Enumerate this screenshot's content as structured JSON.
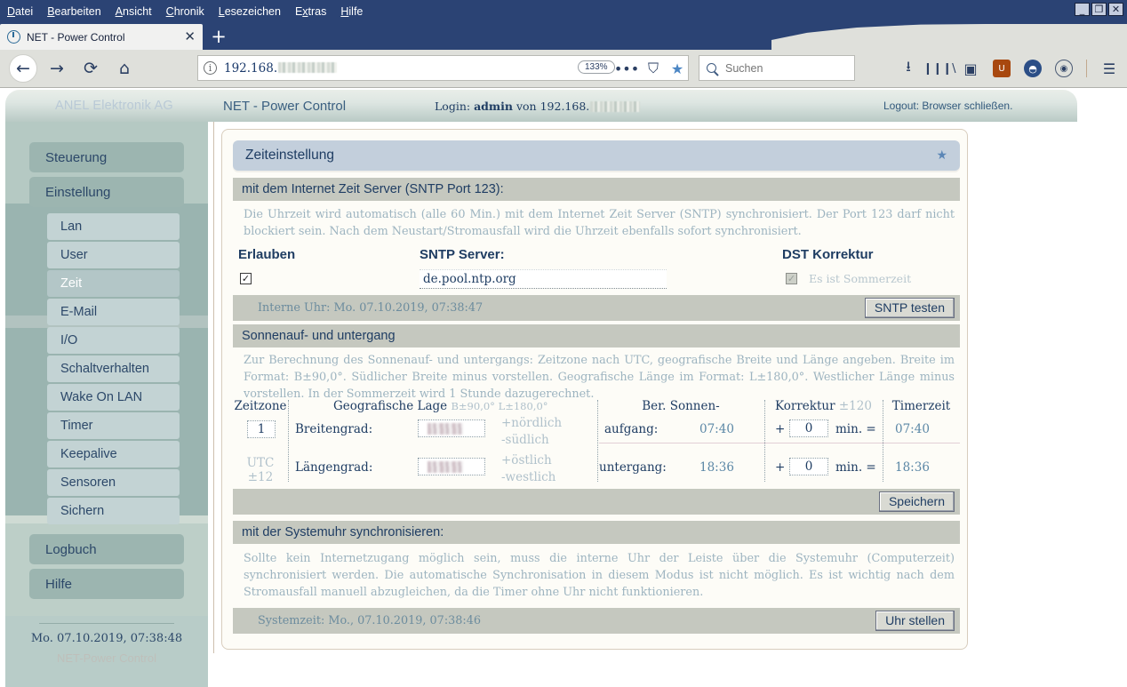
{
  "window": {
    "menu": [
      "Datei",
      "Bearbeiten",
      "Ansicht",
      "Chronik",
      "Lesezeichen",
      "Extras",
      "Hilfe"
    ],
    "controls": {
      "minimize": "_",
      "restore": "❐",
      "close": "✕"
    }
  },
  "browser": {
    "tab_title": "NET - Power Control",
    "tab_close": "✕",
    "new_tab": "+",
    "back": "←",
    "forward": "→",
    "reload": "⟳",
    "home": "⌂",
    "url_prefix": "192.168.",
    "zoom_level": "133%",
    "page_actions": "•••",
    "reader_icon": "⛉",
    "bookmark_star": "★",
    "search_placeholder": "Suchen",
    "search_value": "",
    "toolbar_icons": [
      "download-icon",
      "library-icon",
      "sidebar-icon",
      "shield-icon",
      "account-icon",
      "pocket-icon",
      "menu-icon"
    ],
    "download_glyph": "⭳",
    "library_glyph": "❙❙❙\\",
    "sidebar_glyph": "▣",
    "shield_glyph": "U",
    "account_glyph": "◓",
    "pocket_glyph": "◉",
    "menu_glyph": "☰"
  },
  "app": {
    "brand": "ANEL Elektronik AG",
    "title": "NET - Power Control",
    "login_prefix": "Login:",
    "login_user": "admin",
    "login_mid": "von 192.168.",
    "logout": "Logout: Browser schließen."
  },
  "sidebar": {
    "main_items": [
      {
        "label": "Steuerung"
      },
      {
        "label": "Einstellung"
      }
    ],
    "sub_items": [
      {
        "label": "Lan",
        "active": false
      },
      {
        "label": "User",
        "active": false
      },
      {
        "label": "Zeit",
        "active": true
      },
      {
        "label": "E-Mail",
        "active": false
      },
      {
        "label": "I/O",
        "active": false
      },
      {
        "label": "Schaltverhalten",
        "active": false
      },
      {
        "label": "Wake On LAN",
        "active": false
      },
      {
        "label": "Timer",
        "active": false
      },
      {
        "label": "Keepalive",
        "active": false
      },
      {
        "label": "Sensoren",
        "active": false
      },
      {
        "label": "Sichern",
        "active": false
      }
    ],
    "bottom_items": [
      {
        "label": "Logbuch"
      },
      {
        "label": "Hilfe"
      }
    ],
    "clock": "Mo. 07.10.2019, 07:38:48",
    "ghost_label": "NET-Power Control"
  },
  "panel": {
    "title": "Zeiteinstellung",
    "star": "★"
  },
  "sntp": {
    "heading": "mit dem Internet Zeit Server (SNTP Port 123):",
    "description": "Die Uhrzeit wird automatisch (alle 60 Min.) mit dem Internet Zeit Server (SNTP) synchronisiert. Der Port 123 darf nicht blockiert sein. Nach dem Neustart/Stromausfall wird die Uhrzeit ebenfalls sofort synchronisiert.",
    "allow_label": "Erlauben",
    "allow_checked": true,
    "server_label": "SNTP Server:",
    "server_value": "de.pool.ntp.org",
    "dst_label": "DST Korrektur",
    "dst_checked": true,
    "dst_note": "Es ist Sommerzeit",
    "internal_clock": "Interne Uhr: Mo. 07.10.2019, 07:38:47",
    "test_button": "SNTP testen"
  },
  "sun": {
    "heading": "Sonnenauf- und untergang",
    "description": "Zur Berechnung des Sonnenauf- und untergangs: Zeitzone nach UTC, geografische Breite und Länge angeben. Breite im Format: B±90,0°. Südlicher Breite minus vorstellen. Geografische Länge im Format: L±180,0°. Westlicher Länge minus vorstellen. In der Sommerzeit wird 1 Stunde dazugerechnet.",
    "col_timezone": "Zeitzone",
    "col_geo": "Geografische Lage",
    "col_geo_note": "B±90,0° L±180,0°",
    "col_calc": "Ber. Sonnen-",
    "col_correction": "Korrektur",
    "col_correction_note": "±120",
    "col_timerzeit": "Timerzeit",
    "timezone_value": "1",
    "timezone_note": "UTC ±12",
    "lat_label": "Breitengrad:",
    "lat_value": "",
    "lat_hint_1": "+nördlich",
    "lat_hint_2": "-südlich",
    "lon_label": "Längengrad:",
    "lon_value": "",
    "lon_hint_1": "+östlich",
    "lon_hint_2": "-westlich",
    "rise_label": "aufgang:",
    "rise_time": "07:40",
    "rise_plus": "+",
    "rise_correction": "0",
    "rise_unit": "min. =",
    "rise_result": "07:40",
    "set_label": "untergang:",
    "set_time": "18:36",
    "set_plus": "+",
    "set_correction": "0",
    "set_unit": "min. =",
    "set_result": "18:36",
    "save_button": "Speichern"
  },
  "system": {
    "heading": "mit der Systemuhr synchronisieren:",
    "description": "Sollte kein Internetzugang möglich sein, muss die interne Uhr der Leiste über die Systemuhr (Computerzeit) synchronisiert werden. Die automatische Synchronisation in diesem Modus ist nicht möglich. Es ist wichtig nach dem Stromausfall manuell abzugleichen, da die Timer ohne Uhr nicht funktionieren.",
    "system_time": "Systemzeit: Mo., 07.10.2019, 07:38:46",
    "set_clock_button": "Uhr stellen"
  }
}
